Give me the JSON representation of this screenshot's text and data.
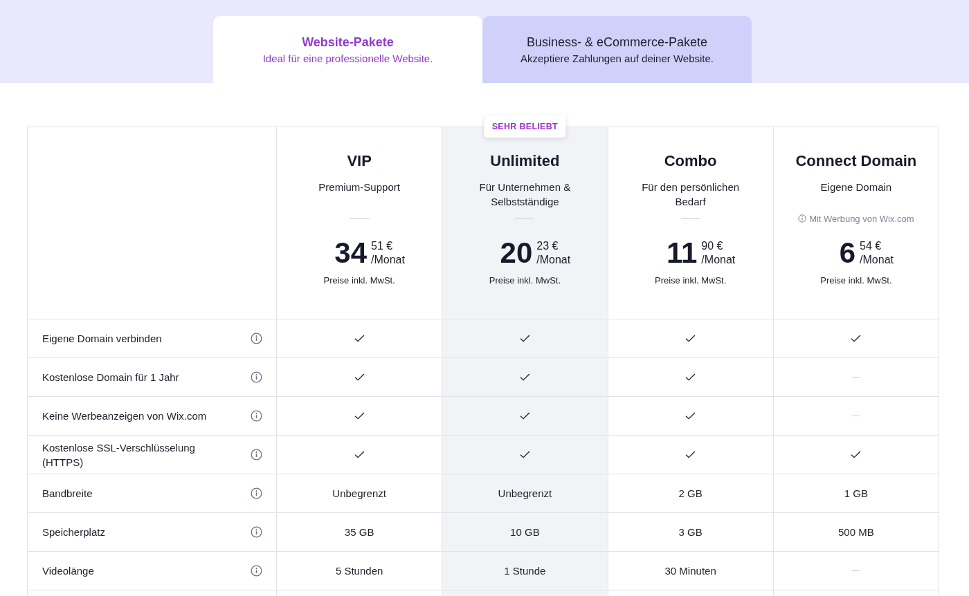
{
  "tabs": [
    {
      "title": "Website-Pakete",
      "subtitle": "Ideal für eine professionelle Website.",
      "selected": true
    },
    {
      "title": "Business- & eCommerce-Pakete",
      "subtitle": "Akzeptiere Zahlungen auf deiner Website.",
      "selected": false
    }
  ],
  "plans": [
    {
      "name": "VIP",
      "subtitle": "Premium-Support",
      "highlighted": false,
      "price_major": "34",
      "price_minor": "51 €",
      "period": "/Monat",
      "tax_note": "Preise inkl. MwSt."
    },
    {
      "name": "Unlimited",
      "subtitle": "Für Unternehmen & Selbstständige",
      "highlighted": true,
      "badge": "SEHR BELIEBT",
      "price_major": "20",
      "price_minor": "23 €",
      "period": "/Monat",
      "tax_note": "Preise inkl. MwSt."
    },
    {
      "name": "Combo",
      "subtitle": "Für den persönlichen Bedarf",
      "highlighted": false,
      "price_major": "11",
      "price_minor": "90 €",
      "period": "/Monat",
      "tax_note": "Preise inkl. MwSt."
    },
    {
      "name": "Connect Domain",
      "subtitle": "Eigene Domain",
      "highlighted": false,
      "note": "Mit Werbung von Wix.com",
      "price_major": "6",
      "price_minor": "54 €",
      "period": "/Monat",
      "tax_note": "Preise inkl. MwSt."
    }
  ],
  "features": [
    {
      "label": "Eigene Domain verbinden",
      "cells": [
        {
          "kind": "check"
        },
        {
          "kind": "check"
        },
        {
          "kind": "check"
        },
        {
          "kind": "check"
        }
      ]
    },
    {
      "label": "Kostenlose Domain für 1 Jahr",
      "cells": [
        {
          "kind": "check"
        },
        {
          "kind": "check"
        },
        {
          "kind": "check"
        },
        {
          "kind": "dash"
        }
      ]
    },
    {
      "label": "Keine Werbeanzeigen von Wix.com",
      "cells": [
        {
          "kind": "check"
        },
        {
          "kind": "check"
        },
        {
          "kind": "check"
        },
        {
          "kind": "dash"
        }
      ]
    },
    {
      "label": "Kostenlose SSL-Verschlüsselung (HTTPS)",
      "cells": [
        {
          "kind": "check"
        },
        {
          "kind": "check"
        },
        {
          "kind": "check"
        },
        {
          "kind": "check"
        }
      ]
    },
    {
      "label": "Bandbreite",
      "cells": [
        {
          "kind": "text",
          "text": "Unbegrenzt"
        },
        {
          "kind": "text",
          "text": "Unbegrenzt"
        },
        {
          "kind": "text",
          "text": "2 GB"
        },
        {
          "kind": "text",
          "text": "1 GB"
        }
      ]
    },
    {
      "label": "Speicherplatz",
      "cells": [
        {
          "kind": "text",
          "text": "35 GB"
        },
        {
          "kind": "text",
          "text": "10 GB"
        },
        {
          "kind": "text",
          "text": "3 GB"
        },
        {
          "kind": "text",
          "text": "500 MB"
        }
      ]
    },
    {
      "label": "Videolänge",
      "cells": [
        {
          "kind": "text",
          "text": "5 Stunden"
        },
        {
          "kind": "text",
          "text": "1 Stunde"
        },
        {
          "kind": "text",
          "text": "30 Minuten"
        },
        {
          "kind": "dash"
        }
      ]
    }
  ]
}
